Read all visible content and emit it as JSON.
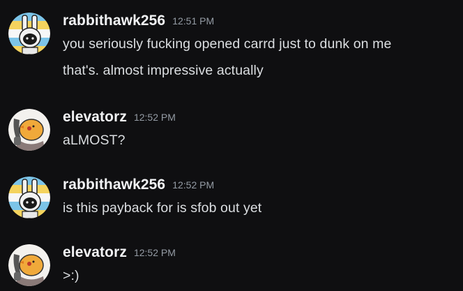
{
  "colors": {
    "background": "#0f0f11",
    "username": "#f2f3f5",
    "timestamp": "#949ba4",
    "message_text": "#dbdee1"
  },
  "messages": [
    {
      "author": "rabbithawk256",
      "avatar": "rabbit-avatar",
      "time": "12:51 PM",
      "lines": [
        "you seriously fucking opened carrd just to dunk on me",
        "that's. almost impressive actually"
      ]
    },
    {
      "author": "elevatorz",
      "avatar": "chick-avatar",
      "time": "12:52 PM",
      "lines": [
        "aLMOST?"
      ]
    },
    {
      "author": "rabbithawk256",
      "avatar": "rabbit-avatar",
      "time": "12:52 PM",
      "lines": [
        "is this payback for is sfob out yet"
      ]
    },
    {
      "author": "elevatorz",
      "avatar": "chick-avatar",
      "time": "12:52 PM",
      "lines": [
        ">:)"
      ]
    }
  ]
}
